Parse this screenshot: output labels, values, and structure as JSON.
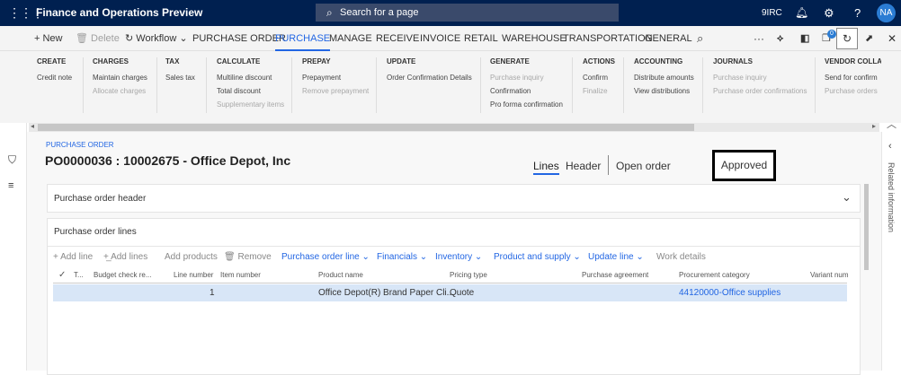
{
  "topbar": {
    "app_title": "Finance and Operations Preview",
    "search_placeholder": "Search for a page",
    "company": "9IRC",
    "avatar_initials": "NA"
  },
  "actionbar": {
    "new": "New",
    "delete": "Delete",
    "workflow": "Workflow",
    "tabs": [
      "PURCHASE ORDER",
      "PURCHASE",
      "MANAGE",
      "RECEIVE",
      "INVOICE",
      "RETAIL",
      "WAREHOUSE",
      "TRANSPORTATION",
      "GENERAL"
    ],
    "active_tab": "PURCHASE",
    "badge_count": "0"
  },
  "ribbon": {
    "groups": [
      {
        "title": "CREATE",
        "items": [
          {
            "label": "Credit note",
            "disabled": false
          }
        ]
      },
      {
        "title": "CHARGES",
        "items": [
          {
            "label": "Maintain charges",
            "disabled": false
          },
          {
            "label": "Allocate charges",
            "disabled": true
          }
        ]
      },
      {
        "title": "TAX",
        "items": [
          {
            "label": "Sales tax",
            "disabled": false
          }
        ]
      },
      {
        "title": "CALCULATE",
        "items": [
          {
            "label": "Multiline discount",
            "disabled": false
          },
          {
            "label": "Total discount",
            "disabled": false
          },
          {
            "label": "Supplementary items",
            "disabled": true
          }
        ]
      },
      {
        "title": "PREPAY",
        "items": [
          {
            "label": "Prepayment",
            "disabled": false
          },
          {
            "label": "Remove prepayment",
            "disabled": true
          }
        ]
      },
      {
        "title": "UPDATE",
        "items": [
          {
            "label": "Order Confirmation Details",
            "disabled": false
          }
        ]
      },
      {
        "title": "GENERATE",
        "items": [
          {
            "label": "Purchase inquiry",
            "disabled": true
          },
          {
            "label": "Confirmation",
            "disabled": false
          },
          {
            "label": "Pro forma confirmation",
            "disabled": false
          }
        ]
      },
      {
        "title": "ACTIONS",
        "items": [
          {
            "label": "Confirm",
            "disabled": false
          },
          {
            "label": "Finalize",
            "disabled": true
          }
        ]
      },
      {
        "title": "ACCOUNTING",
        "items": [
          {
            "label": "Distribute amounts",
            "disabled": false
          },
          {
            "label": "View distributions",
            "disabled": false
          }
        ]
      },
      {
        "title": "JOURNALS",
        "items": [
          {
            "label": "Purchase inquiry",
            "disabled": true
          },
          {
            "label": "Purchase order confirmations",
            "disabled": true
          }
        ]
      },
      {
        "title": "VENDOR COLLAB",
        "items": [
          {
            "label": "Send for confirm",
            "disabled": false
          },
          {
            "label": "Purchase orders",
            "disabled": true
          }
        ]
      }
    ]
  },
  "page": {
    "breadcrumb": "PURCHASE ORDER",
    "title": "PO0000036 : 10002675 - Office Depot, Inc",
    "views": [
      "Lines",
      "Header"
    ],
    "open_order": "Open order",
    "status": "Approved"
  },
  "sections": {
    "header_title": "Purchase order header",
    "lines_title": "Purchase order lines"
  },
  "lines_toolbar": {
    "add_line": "Add line",
    "add_lines": "Add lines",
    "add_products": "Add products",
    "remove": "Remove",
    "menus": [
      "Purchase order line",
      "Financials",
      "Inventory",
      "Product and supply",
      "Update line"
    ],
    "work_details": "Work details"
  },
  "grid": {
    "columns": [
      "T...",
      "Budget check re...",
      "Line number",
      "Item number",
      "Product name",
      "Pricing type",
      "Purchase agreement",
      "Procurement category",
      "Variant num"
    ],
    "rows": [
      {
        "type": "",
        "budget": "",
        "line_number": "1",
        "item_number": "",
        "product_name": "Office Depot(R) Brand Paper Cli...",
        "pricing_type": "Quote",
        "purchase_agreement": "",
        "procurement_category": "44120000-Office supplies",
        "variant": ""
      }
    ]
  },
  "rightrail": {
    "label": "Related information"
  },
  "colors": {
    "navbar": "#002050",
    "accent": "#2266e3",
    "selected_row": "#d8e6f7"
  }
}
